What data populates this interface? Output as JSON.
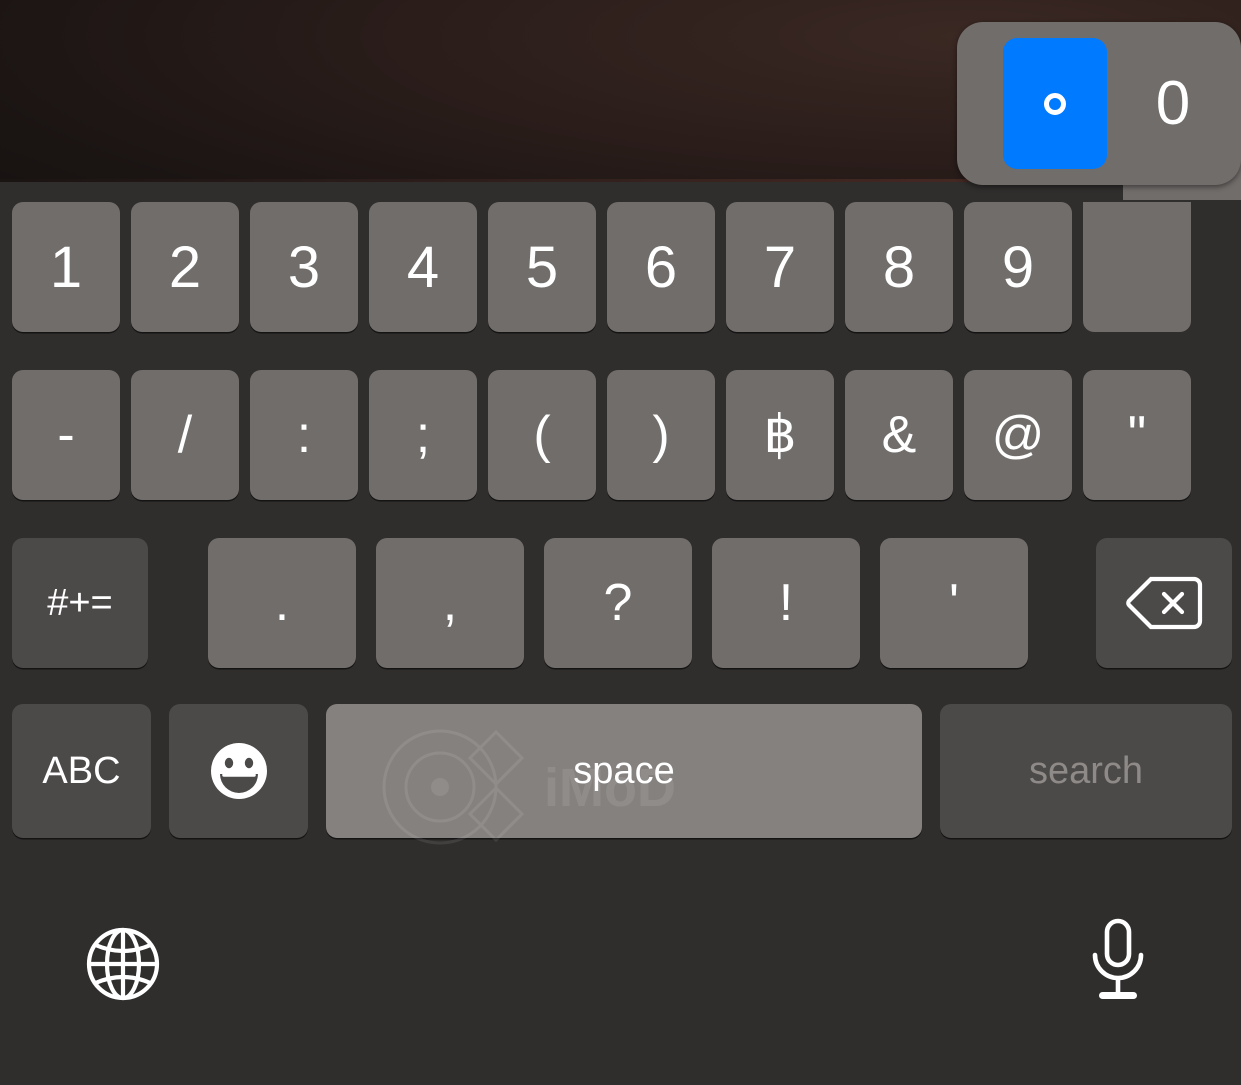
{
  "platform": "ios-keyboard",
  "keyboard": {
    "layout_name": "numbers-symbols",
    "background_color": "#302e2d",
    "key_color": "#716d6b",
    "special_key_color": "#4c4a49",
    "accent_color": "#007aff",
    "rows": [
      {
        "id": "row-numbers",
        "keys": [
          {
            "name": "key-1",
            "label": "1",
            "style": "normal"
          },
          {
            "name": "key-2",
            "label": "2",
            "style": "normal"
          },
          {
            "name": "key-3",
            "label": "3",
            "style": "normal"
          },
          {
            "name": "key-4",
            "label": "4",
            "style": "normal"
          },
          {
            "name": "key-5",
            "label": "5",
            "style": "normal"
          },
          {
            "name": "key-6",
            "label": "6",
            "style": "normal"
          },
          {
            "name": "key-7",
            "label": "7",
            "style": "normal"
          },
          {
            "name": "key-8",
            "label": "8",
            "style": "normal"
          },
          {
            "name": "key-9",
            "label": "9",
            "style": "normal"
          },
          {
            "name": "key-0",
            "label": "0",
            "style": "pressed"
          }
        ]
      },
      {
        "id": "row-symbols",
        "keys": [
          {
            "name": "key-hyphen",
            "label": "-",
            "style": "normal"
          },
          {
            "name": "key-slash",
            "label": "/",
            "style": "normal"
          },
          {
            "name": "key-colon",
            "label": ":",
            "style": "normal"
          },
          {
            "name": "key-semicolon",
            "label": ";",
            "style": "normal"
          },
          {
            "name": "key-paren-open",
            "label": "(",
            "style": "normal"
          },
          {
            "name": "key-paren-close",
            "label": ")",
            "style": "normal"
          },
          {
            "name": "key-baht",
            "label": "฿",
            "style": "normal"
          },
          {
            "name": "key-ampersand",
            "label": "&",
            "style": "normal"
          },
          {
            "name": "key-at",
            "label": "@",
            "style": "normal"
          },
          {
            "name": "key-quote-double",
            "label": "\"",
            "style": "normal"
          }
        ]
      },
      {
        "id": "row-punctuation",
        "keys": [
          {
            "name": "key-symbols-toggle",
            "label": "#+=",
            "style": "dark"
          },
          {
            "name": "key-period",
            "label": ".",
            "style": "normal"
          },
          {
            "name": "key-comma",
            "label": ",",
            "style": "normal"
          },
          {
            "name": "key-question",
            "label": "?",
            "style": "normal"
          },
          {
            "name": "key-exclamation",
            "label": "!",
            "style": "normal"
          },
          {
            "name": "key-apostrophe",
            "label": "'",
            "style": "normal"
          },
          {
            "name": "key-delete",
            "label": "delete-icon",
            "style": "dark"
          }
        ]
      },
      {
        "id": "row-bottom",
        "keys": [
          {
            "name": "key-abc",
            "label": "ABC",
            "style": "dark"
          },
          {
            "name": "key-emoji",
            "label": "emoji-icon",
            "style": "dark"
          },
          {
            "name": "key-space",
            "label": "space",
            "style": "light"
          },
          {
            "name": "key-search",
            "label": "search",
            "style": "dark",
            "state": "disabled"
          }
        ]
      }
    ]
  },
  "key_popup": {
    "source_key": "0",
    "visible": true,
    "selected_index": 0,
    "options": [
      {
        "name": "popup-option-degree",
        "label": "°",
        "selected": true
      },
      {
        "name": "popup-option-zero",
        "label": "0",
        "selected": false
      }
    ],
    "highlight_color": "#007aff",
    "background_color": "#716d6b"
  },
  "utility_bar": {
    "globe": {
      "name": "globe-icon",
      "label": "Next keyboard"
    },
    "mic": {
      "name": "microphone-icon",
      "label": "Dictation"
    }
  },
  "watermark": {
    "text": "iMoD"
  }
}
